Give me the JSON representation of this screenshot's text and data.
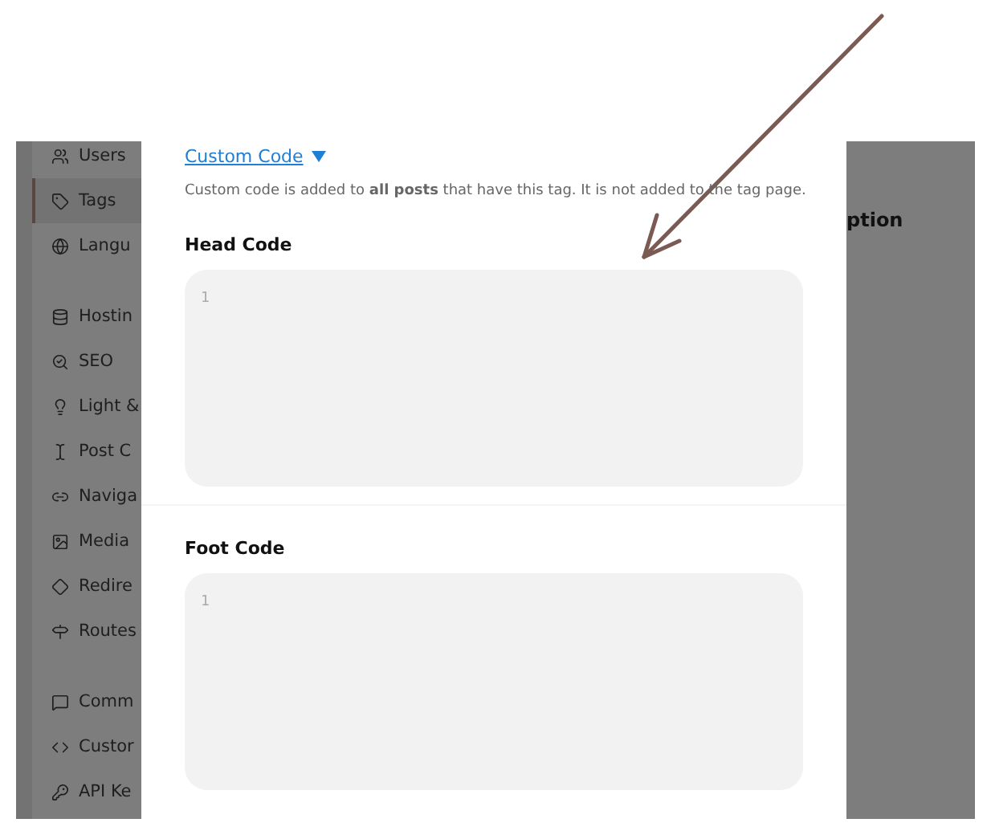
{
  "sidebar": {
    "groups": [
      {
        "items": [
          {
            "label": "Users",
            "selected": false
          },
          {
            "label": "Tags",
            "selected": true
          },
          {
            "label": "Langu",
            "selected": false
          }
        ]
      },
      {
        "items": [
          {
            "label": "Hostin",
            "selected": false
          },
          {
            "label": "SEO",
            "selected": false
          },
          {
            "label": "Light &",
            "selected": false
          },
          {
            "label": "Post C",
            "selected": false
          },
          {
            "label": "Naviga",
            "selected": false
          },
          {
            "label": "Media",
            "selected": false
          },
          {
            "label": "Redire",
            "selected": false
          },
          {
            "label": "Routes",
            "selected": false
          }
        ]
      },
      {
        "items": [
          {
            "label": "Comm",
            "selected": false
          },
          {
            "label": "Custor",
            "selected": false
          },
          {
            "label": "API Ke",
            "selected": false
          }
        ]
      }
    ]
  },
  "background_panel": {
    "heading": "ption"
  },
  "dialog": {
    "section_toggle": {
      "label": "Custom Code",
      "expanded": true
    },
    "description": "Custom code is added to **all posts** that have this tag. It is not added to the tag page.",
    "editors": [
      {
        "label": "Head Code",
        "line_number": "1"
      },
      {
        "label": "Foot Code",
        "line_number": "1"
      }
    ]
  }
}
